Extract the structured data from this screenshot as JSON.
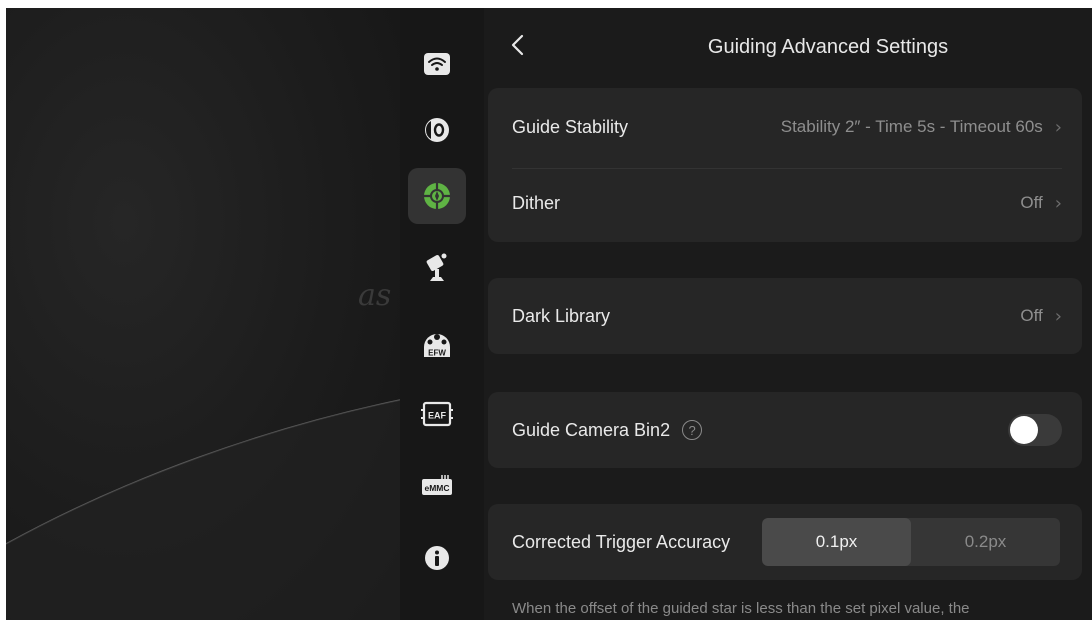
{
  "header": {
    "title": "Guiding Advanced Settings"
  },
  "background": {
    "watermark": "as"
  },
  "sidebar": {
    "items": [
      {
        "icon": "wifi-icon",
        "label": ""
      },
      {
        "icon": "camera-zero-icon",
        "label": ""
      },
      {
        "icon": "guiding-crosshair-icon",
        "label": "",
        "active": true
      },
      {
        "icon": "telescope-mount-icon",
        "label": ""
      },
      {
        "icon": "filter-wheel-icon",
        "label": "EFW"
      },
      {
        "icon": "focuser-icon",
        "label": "EAF"
      },
      {
        "icon": "storage-icon",
        "label": "eMMC"
      },
      {
        "icon": "info-icon",
        "label": ""
      }
    ]
  },
  "settings": {
    "guide_stability": {
      "label": "Guide Stability",
      "value": "Stability 2″ - Time 5s - Timeout 60s"
    },
    "dither": {
      "label": "Dither",
      "value": "Off"
    },
    "dark_library": {
      "label": "Dark Library",
      "value": "Off"
    },
    "guide_camera_bin2": {
      "label": "Guide Camera Bin2",
      "help": "?",
      "enabled": false
    },
    "corrected_trigger_accuracy": {
      "label": "Corrected Trigger Accuracy",
      "options": [
        "0.1px",
        "0.2px"
      ],
      "selected": "0.1px"
    },
    "note": "When the offset of the guided star is less than the set pixel value, the"
  },
  "colors": {
    "background": "#1b1b1b",
    "card": "#262626",
    "accent_green": "#5fb344",
    "text_primary": "#e9e9e9",
    "text_secondary": "#8e8e8e"
  }
}
